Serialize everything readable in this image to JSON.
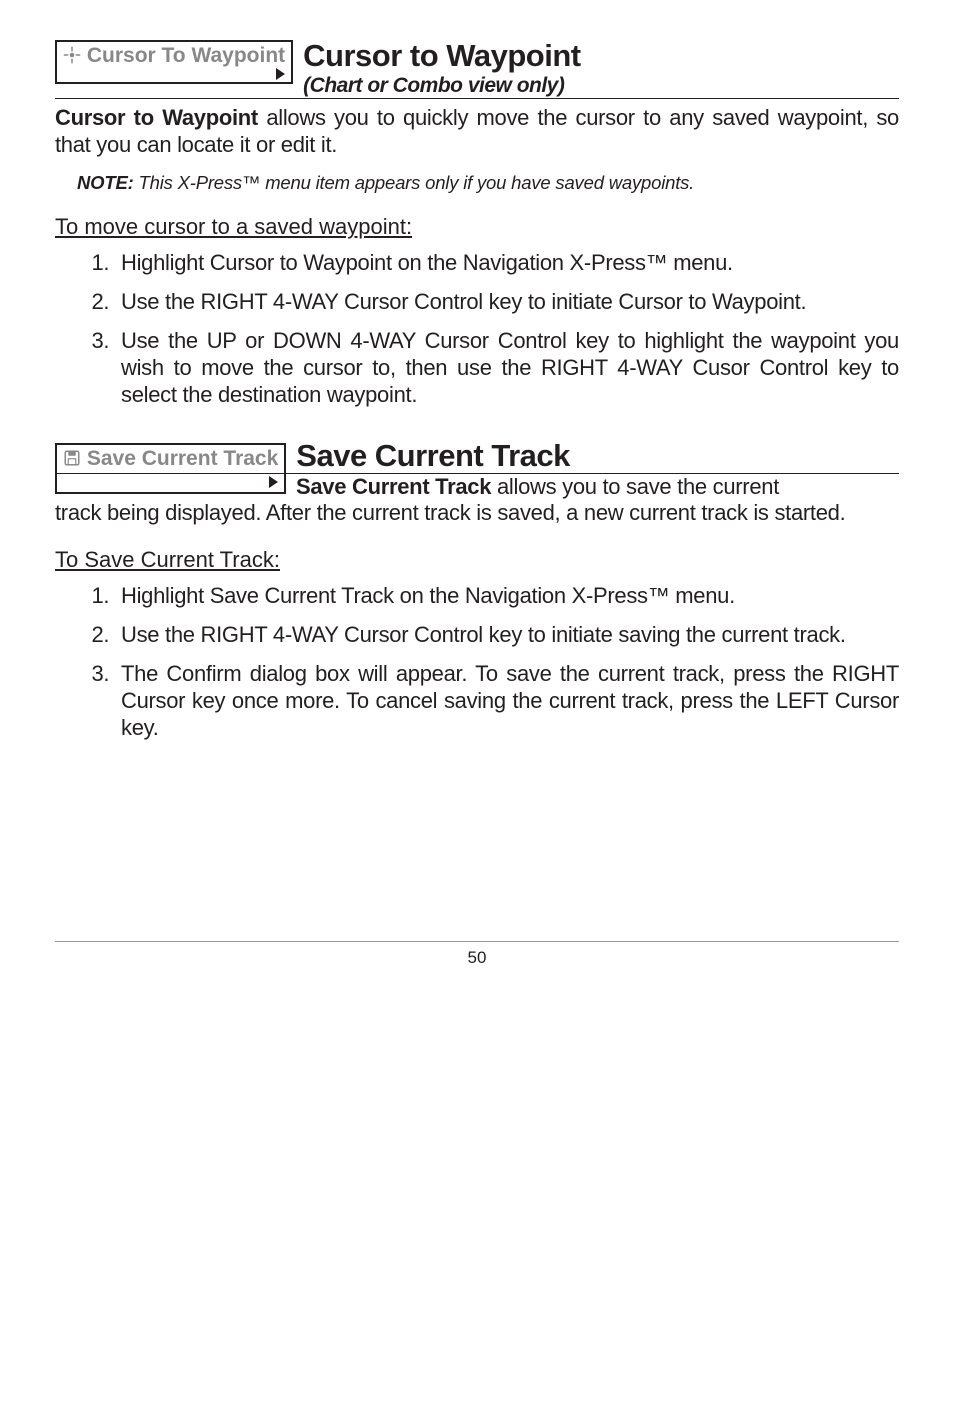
{
  "section1": {
    "menu_label": "Cursor To Waypoint",
    "title": "Cursor to Waypoint",
    "subtitle": "(Chart or Combo view only)",
    "body_html": "<b>Cursor to Waypoint</b> allows you to quickly move the cursor to any saved waypoint, so that you can locate it or edit it.",
    "note_html": "<b>NOTE:</b> This X-Press™ menu item appears only if you have saved waypoints.",
    "subheading": "To move cursor to a saved waypoint:",
    "steps": [
      "Highlight Cursor to Waypoint on the Navigation X-Press™ menu.",
      "Use the RIGHT 4-WAY Cursor Control key to initiate Cursor to Waypoint.",
      "Use the UP or DOWN 4-WAY Cursor Control key to highlight the waypoint you wish to move the cursor to, then use the RIGHT 4-WAY Cusor Control key to select the destination waypoint."
    ]
  },
  "section2": {
    "menu_label": "Save Current Track",
    "title": "Save Current Track",
    "body_first_html": "<b>Save Current Track</b> allows you to save the current",
    "body_rest": "track being displayed. After the current track is saved, a new current track is started.",
    "subheading": "To Save Current Track:",
    "steps": [
      "Highlight Save Current Track on the Navigation X-Press™ menu.",
      "Use the RIGHT 4-WAY Cursor Control key to initiate saving the current track.",
      "The Confirm dialog box will appear. To save the current track,  press the RIGHT Cursor key once more. To cancel saving the current track, press the LEFT Cursor key."
    ]
  },
  "page_number": "50"
}
